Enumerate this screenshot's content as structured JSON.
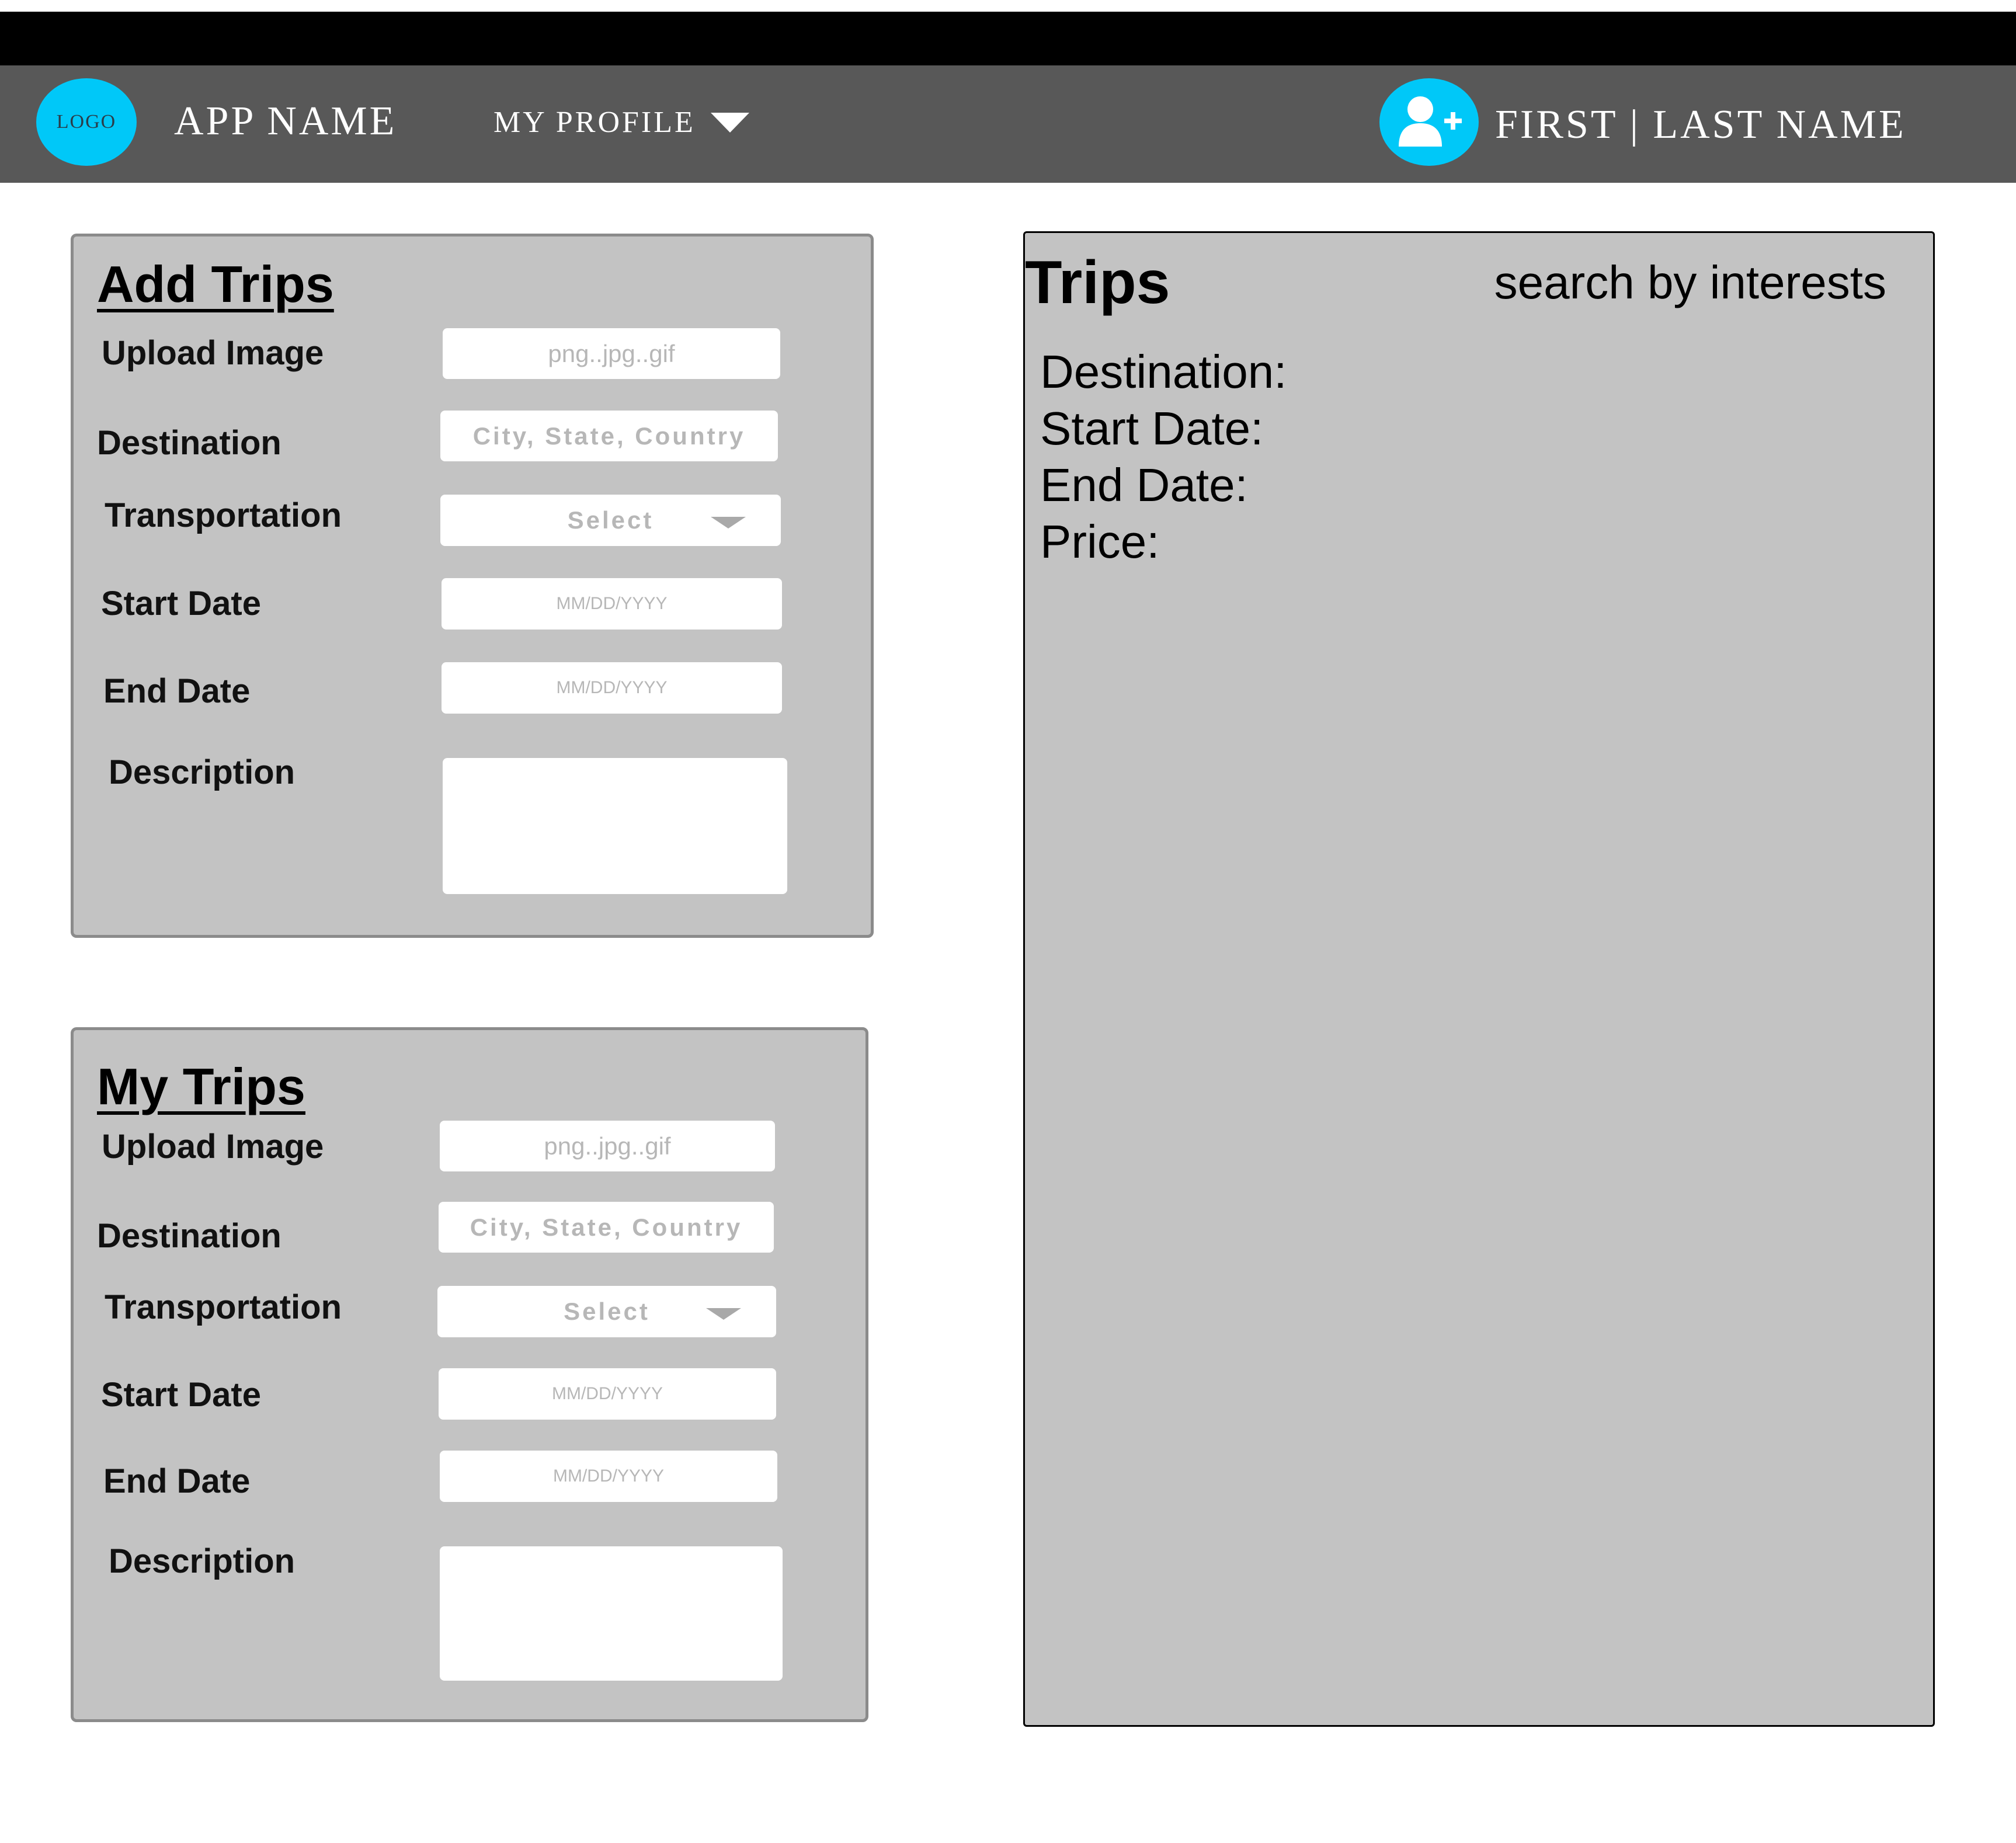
{
  "header": {
    "logo": "LOGO",
    "app_name": "APP NAME",
    "profile_menu": "MY PROFILE",
    "user_name": "FIRST | LAST NAME",
    "accent_color": "#00c8f8",
    "icons": [
      "user-plus-icon",
      "chevron-down-icon"
    ]
  },
  "add_trips": {
    "title": "Add Trips",
    "upload_label": "Upload Image",
    "upload_placeholder": "png..jpg..gif",
    "destination_label": "Destination",
    "destination_placeholder": "City, State, Country",
    "transportation_label": "Transportation",
    "transportation_value": "Select",
    "start_label": "Start Date",
    "start_placeholder": "MM/DD/YYYY",
    "end_label": "End Date",
    "end_placeholder": "MM/DD/YYYY",
    "description_label": "Description",
    "description_value": ""
  },
  "my_trips": {
    "title": "My Trips",
    "upload_label": "Upload Image",
    "upload_placeholder": "png..jpg..gif",
    "destination_label": "Destination",
    "destination_placeholder": "City, State, Country",
    "transportation_label": "Transportation",
    "transportation_value": "Select",
    "start_label": "Start Date",
    "start_placeholder": "MM/DD/YYYY",
    "end_label": "End Date",
    "end_placeholder": "MM/DD/YYYY",
    "description_label": "Description",
    "description_value": ""
  },
  "trips": {
    "title": "Trips",
    "search_text": "search by interests",
    "destination_label": "Destination:",
    "start_label": "Start Date:",
    "end_label": "End Date:",
    "price_label": "Price:"
  }
}
